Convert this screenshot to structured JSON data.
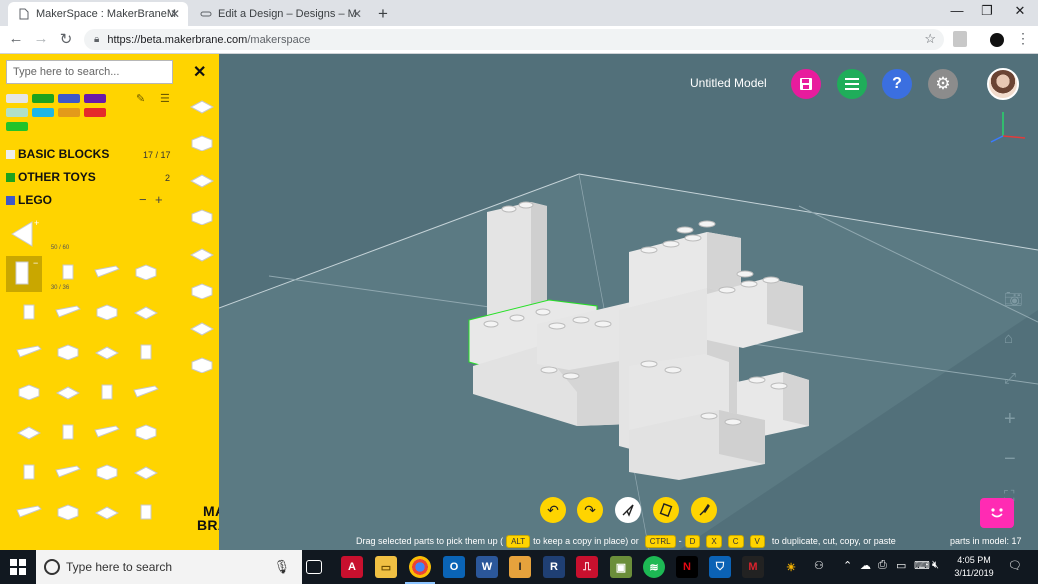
{
  "browser": {
    "tabs": [
      {
        "title": "MakerSpace : MakerBraneMakerS",
        "active": true
      },
      {
        "title": "Edit a Design – Designs – Megan",
        "active": false
      }
    ],
    "url_host": "https://beta.makerbrane.com",
    "url_path": "/makerspace"
  },
  "sidebar": {
    "search_placeholder": "Type here to search...",
    "colors": [
      "#e6e6e6",
      "#1da21d",
      "#3e58c8",
      "#6a1aa8",
      "#b0e0c8",
      "#1eb6e6",
      "#e39a1a",
      "#e52a2a",
      "#22c32a"
    ],
    "categories": [
      {
        "label": "BASIC BLOCKS",
        "count": "17 / 17",
        "color": "#eeeeee"
      },
      {
        "label": "OTHER TOYS",
        "count": "2",
        "color": "#1da21d"
      },
      {
        "label": "LEGO",
        "count": "",
        "color": "#3e58c8"
      }
    ],
    "selected_tiles": [
      {
        "caption": "50 / 60"
      },
      {
        "caption": "30 / 36"
      }
    ],
    "logo_line1": "MAKER",
    "logo_line2": "BRANE"
  },
  "viewport": {
    "model_title": "Untitled Model",
    "accent_colors": {
      "save": "#e81c9d",
      "menu": "#1fad5a",
      "help": "#3b6fe0",
      "settings": "#8c8c8c"
    },
    "hint_before": "Drag selected parts to pick them up (",
    "hint_alt": "ALT",
    "hint_mid": "to keep a copy in place) or",
    "hint_ctrl": "CTRL",
    "hint_sep": "-",
    "hint_d": "D",
    "hint_x": "X",
    "hint_c": "C",
    "hint_v": "V",
    "hint_after": "to duplicate, cut, copy, or paste",
    "parts_label": "parts in model: 17"
  },
  "taskbar": {
    "search_text": "Type here to search",
    "time": "4:05 PM",
    "date": "3/11/2019"
  }
}
